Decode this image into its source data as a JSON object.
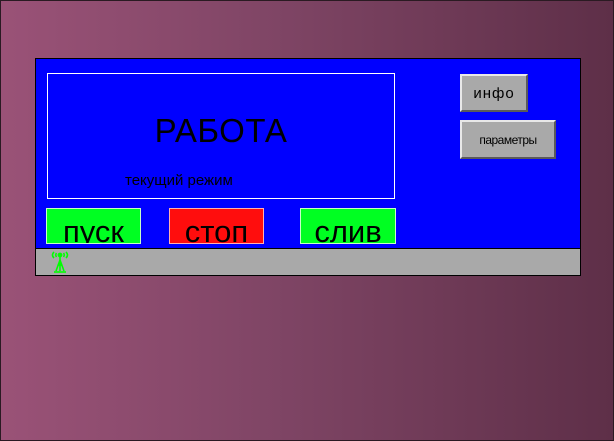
{
  "display": {
    "state_text": "РАБОТА",
    "mode_label": "текущий режим"
  },
  "buttons": {
    "info_label": "инфо",
    "params_label": "параметры",
    "start_label": "пуск",
    "stop_label": "стоп",
    "drain_label": "слив"
  },
  "colors": {
    "background_gradient": [
      "#9a5277",
      "#5e2f48"
    ],
    "panel": "#0000ff",
    "start": "#00ff22",
    "stop": "#ff0d0d",
    "drain": "#00ff22",
    "gray_button": "#a9a9a9",
    "status_bar": "#a9a9a9",
    "signal_icon": "#00ff00"
  },
  "status_bar": {
    "icon": "antenna-icon"
  }
}
